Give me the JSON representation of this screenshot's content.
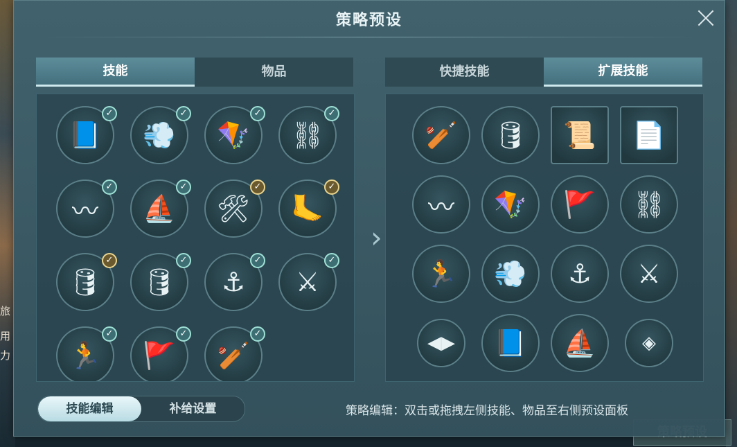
{
  "title": "策略预设",
  "background": {
    "left_text": [
      "旅",
      "用",
      "力"
    ],
    "bottom_right_button": "策略预设"
  },
  "left_tabs": [
    {
      "label": "技能",
      "active": true
    },
    {
      "label": "物品",
      "active": false
    }
  ],
  "right_tabs": [
    {
      "label": "快捷技能",
      "active": false
    },
    {
      "label": "扩展技能",
      "active": true
    }
  ],
  "left_skills": [
    {
      "icon": "skill-book-icon",
      "checked": "teal"
    },
    {
      "icon": "cannonball-dash-icon",
      "checked": "teal"
    },
    {
      "icon": "kite-cannonball-icon",
      "checked": "teal"
    },
    {
      "icon": "chain-shot-icon",
      "checked": "teal"
    },
    {
      "icon": "volley-claw-icon",
      "checked": "teal"
    },
    {
      "icon": "ship-ram-icon",
      "checked": "teal"
    },
    {
      "icon": "ship-repair-icon",
      "checked": "gold"
    },
    {
      "icon": "bandaged-foot-icon",
      "checked": "gold"
    },
    {
      "icon": "powder-barrel-splash-icon",
      "checked": "gold"
    },
    {
      "icon": "powder-barrel-icon",
      "checked": "teal"
    },
    {
      "icon": "fleet-battle-icon",
      "checked": "teal"
    },
    {
      "icon": "swap-swords-icon",
      "checked": "teal"
    },
    {
      "icon": "carry-cannonballs-icon",
      "checked": "teal"
    },
    {
      "icon": "sail-flag-icon",
      "checked": "teal"
    },
    {
      "icon": "oar-icon",
      "checked": "teal"
    }
  ],
  "right_skills": [
    {
      "icon": "oar-icon",
      "shape": "circle"
    },
    {
      "icon": "powder-barrel-icon",
      "shape": "circle"
    },
    {
      "icon": "scroll-icon",
      "shape": "square"
    },
    {
      "icon": "wanted-poster-icon",
      "shape": "square"
    },
    {
      "icon": "volley-claw-icon",
      "shape": "circle"
    },
    {
      "icon": "kite-cannonball-icon",
      "shape": "circle"
    },
    {
      "icon": "sail-flag-icon",
      "shape": "circle"
    },
    {
      "icon": "chain-shot-icon",
      "shape": "circle"
    },
    {
      "icon": "carry-cannonballs-icon",
      "shape": "circle"
    },
    {
      "icon": "cannonball-dash-icon",
      "shape": "circle"
    },
    {
      "icon": "fleet-battle-icon",
      "shape": "circle"
    },
    {
      "icon": "swap-swords-icon",
      "shape": "circle"
    },
    {
      "icon": "left-right-arrows-icon",
      "shape": "small"
    },
    {
      "icon": "skill-book-icon",
      "shape": "circle"
    },
    {
      "icon": "ship-ram-icon",
      "shape": "circle"
    },
    {
      "icon": "layers-icon",
      "shape": "small"
    }
  ],
  "toggle": [
    {
      "label": "技能编辑",
      "active": true
    },
    {
      "label": "补给设置",
      "active": false
    }
  ],
  "hint": "策略编辑：双击或拖拽左侧技能、物品至右侧预设面板"
}
